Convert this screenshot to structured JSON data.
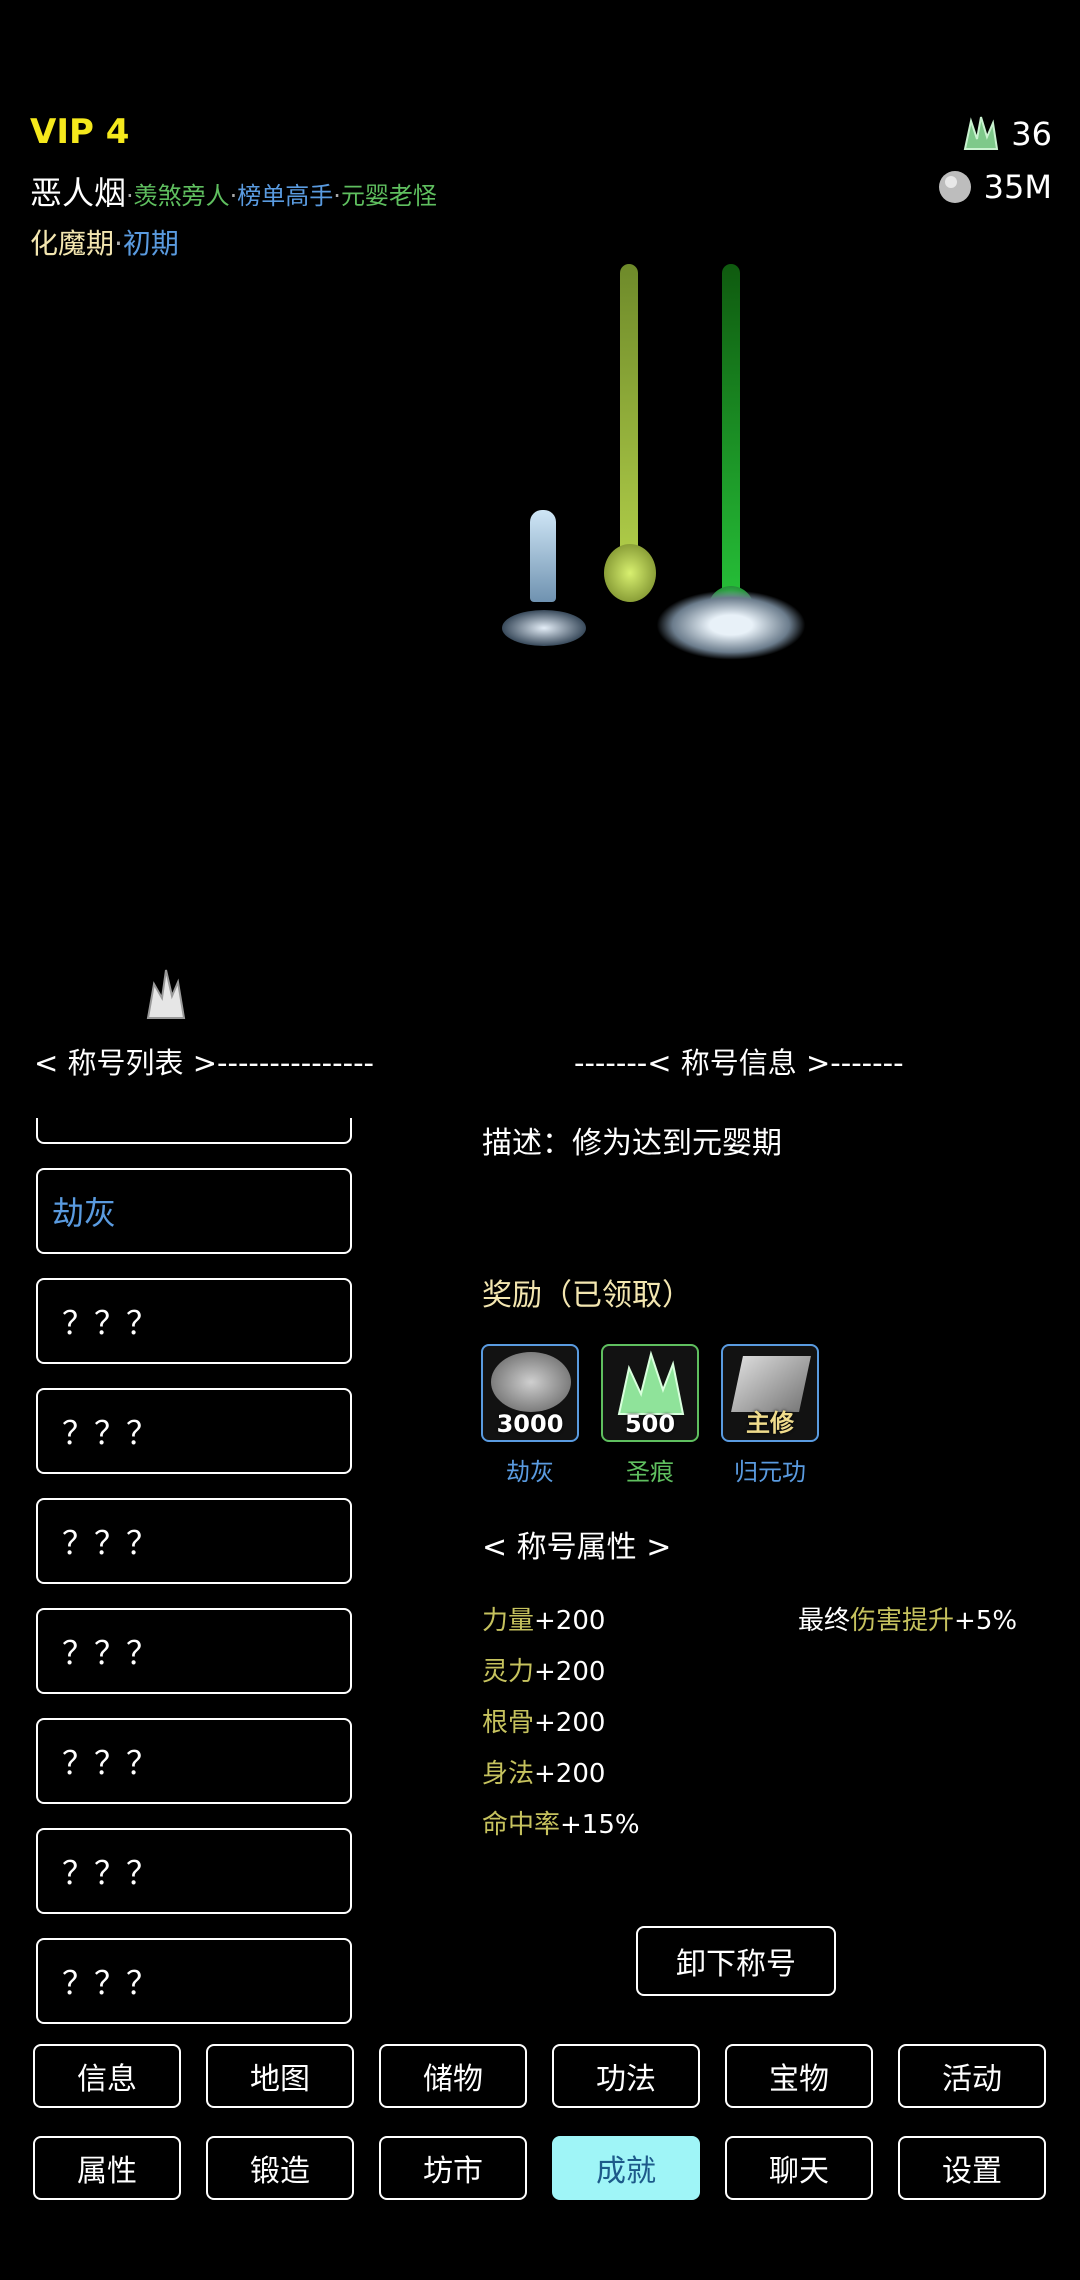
{
  "player": {
    "vip": "VIP 4",
    "name": "恶人烟",
    "titles": [
      "羡煞旁人",
      "榜单高手",
      "元婴老怪"
    ],
    "separator": "·",
    "realm": "化魔期",
    "stage": "初期"
  },
  "currency": {
    "jade": "36",
    "silver": "35M"
  },
  "section_headers": {
    "list": "< 称号列表 >---------------",
    "info": "-------< 称号信息 >-------"
  },
  "title_list": [
    "劫灰",
    "？？？",
    "？？？",
    "？？？",
    "？？？",
    "？？？",
    "？？？",
    "？？？"
  ],
  "info": {
    "description": "描述：修为达到元婴期",
    "reward_title": "奖励（已领取）",
    "rewards": [
      {
        "count": "3000",
        "label": "劫灰",
        "color": "#5a9be0"
      },
      {
        "count": "500",
        "label": "圣痕",
        "color": "#5fbf5f"
      },
      {
        "count": "主修",
        "label": "归元功",
        "color": "#5a9be0"
      }
    ],
    "attr_title": "< 称号属性 >",
    "stats": [
      {
        "k": "力量",
        "v": "+200"
      },
      {
        "k": "灵力",
        "v": "+200"
      },
      {
        "k": "根骨",
        "v": "+200"
      },
      {
        "k": "身法",
        "v": "+200"
      },
      {
        "k": "命中率",
        "v": "+15%"
      }
    ],
    "final": {
      "pre": "最终",
      "k": "伤害提升",
      "v": "+5%"
    },
    "unequip": "卸下称号"
  },
  "nav_row1": [
    "信息",
    "地图",
    "储物",
    "功法",
    "宝物",
    "活动"
  ],
  "nav_row2": [
    "属性",
    "锻造",
    "坊市",
    "成就",
    "聊天",
    "设置"
  ]
}
